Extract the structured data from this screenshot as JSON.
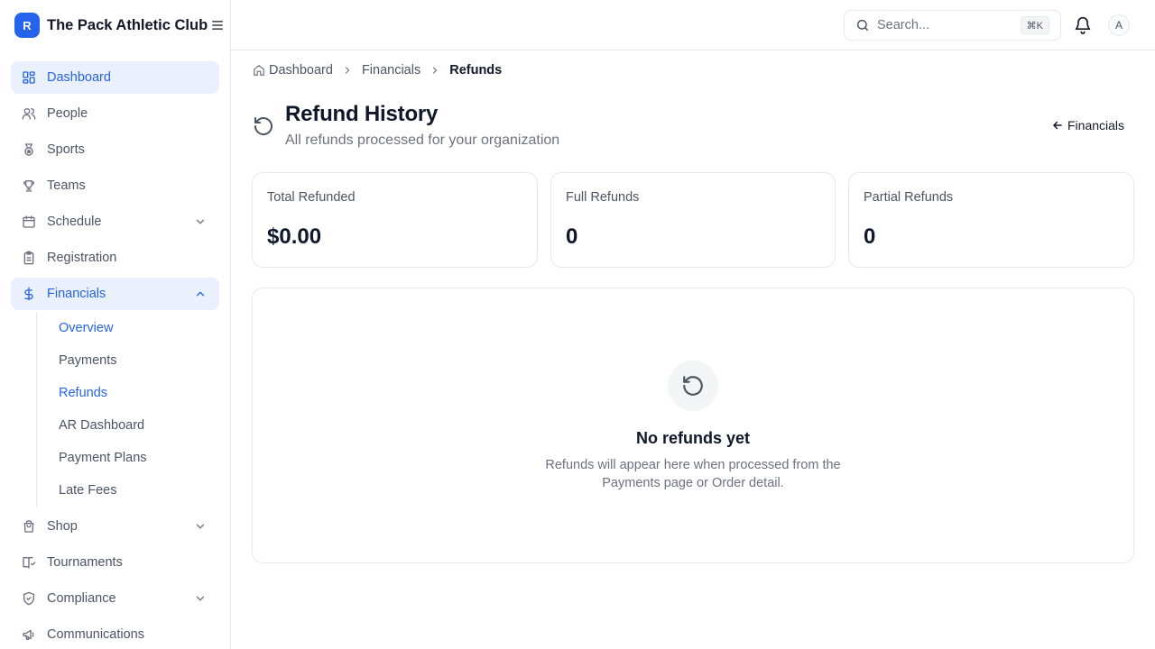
{
  "brand": {
    "logo_letter": "R",
    "name": "The Pack Athletic Club"
  },
  "sidebar": {
    "items": [
      {
        "label": "Dashboard",
        "icon": "layout-dashboard-icon"
      },
      {
        "label": "People",
        "icon": "users-icon"
      },
      {
        "label": "Sports",
        "icon": "medal-icon"
      },
      {
        "label": "Teams",
        "icon": "trophy-icon"
      },
      {
        "label": "Schedule",
        "icon": "calendar-icon"
      },
      {
        "label": "Registration",
        "icon": "clipboard-icon"
      },
      {
        "label": "Financials",
        "icon": "dollar-sign-icon"
      },
      {
        "label": "Shop",
        "icon": "shopping-bag-icon"
      },
      {
        "label": "Tournaments",
        "icon": "book-icon"
      },
      {
        "label": "Compliance",
        "icon": "shield-check-icon"
      },
      {
        "label": "Communications",
        "icon": "megaphone-icon"
      }
    ],
    "financials_sub": [
      {
        "label": "Overview"
      },
      {
        "label": "Payments"
      },
      {
        "label": "Refunds"
      },
      {
        "label": "AR Dashboard"
      },
      {
        "label": "Payment Plans"
      },
      {
        "label": "Late Fees"
      }
    ]
  },
  "header": {
    "search_placeholder": "Search...",
    "search_shortcut": "⌘K",
    "avatar_initial": "A"
  },
  "breadcrumb": [
    "Dashboard",
    "Financials",
    "Refunds"
  ],
  "page": {
    "title": "Refund History",
    "subtitle": "All refunds processed for your organization",
    "back_label": "Financials"
  },
  "stats": [
    {
      "label": "Total Refunded",
      "value": "$0.00"
    },
    {
      "label": "Full Refunds",
      "value": "0"
    },
    {
      "label": "Partial Refunds",
      "value": "0"
    }
  ],
  "empty_state": {
    "title": "No refunds yet",
    "text": "Refunds will appear here when processed from the Payments page or Order detail."
  },
  "colors": {
    "accent": "#2563eb",
    "active_bg": "#eaf0fe"
  }
}
